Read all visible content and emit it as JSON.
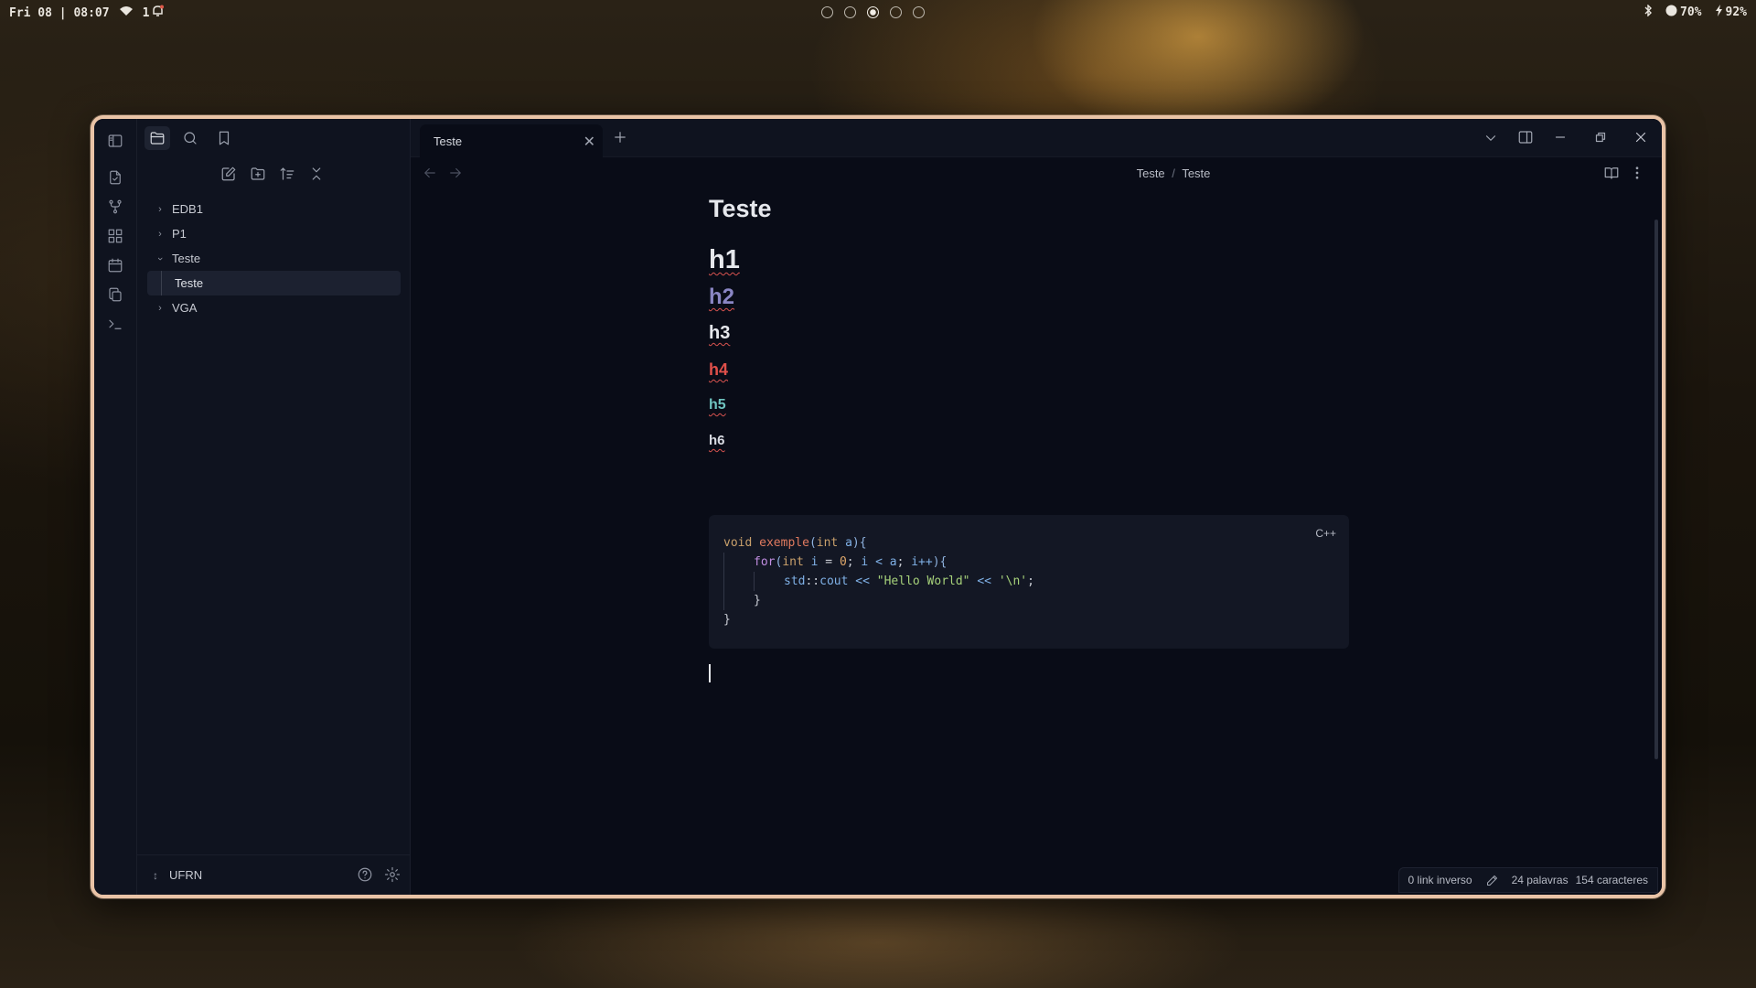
{
  "topbar": {
    "datetime": "Fri 08 | 08:07",
    "notifications": "1",
    "workspaces": [
      false,
      false,
      true,
      false,
      false
    ],
    "volume": "70%",
    "battery": "92%"
  },
  "ribbon": {
    "icons": [
      "file-plus-icon",
      "git-branch-icon",
      "layout-grid-icon",
      "calendar-icon",
      "copy-icon",
      "terminal-icon"
    ]
  },
  "sidebar": {
    "tree": [
      {
        "label": "EDB1",
        "expanded": false
      },
      {
        "label": "P1",
        "expanded": false
      },
      {
        "label": "Teste",
        "expanded": true,
        "children": [
          {
            "label": "Teste",
            "active": true
          }
        ]
      },
      {
        "label": "VGA",
        "expanded": false
      }
    ],
    "vault_name": "UFRN"
  },
  "tabs": [
    {
      "label": "Teste",
      "active": true
    }
  ],
  "breadcrumb": {
    "folder": "Teste",
    "sep": "/",
    "file": "Teste"
  },
  "editor": {
    "title": "Teste",
    "headings": [
      {
        "label": "h1",
        "color": "#e6e8ed"
      },
      {
        "label": "h2",
        "color": "#8a86c4"
      },
      {
        "label": "h3",
        "color": "#e6e8ed"
      },
      {
        "label": "h4",
        "color": "#e0504a"
      },
      {
        "label": "h5",
        "color": "#6fc4c0"
      },
      {
        "label": "h6",
        "color": "#d8dbe2"
      }
    ],
    "code": {
      "language": "C++",
      "lines": [
        "void exemple(int a){",
        "    for(int i = 0; i < a; i++){",
        "        std::cout << \"Hello World\" << '\\n';",
        "    }",
        "}"
      ]
    }
  },
  "status": {
    "backlinks": "0 link inverso",
    "words": "24 palavras",
    "chars": "154 caracteres"
  },
  "colors": {
    "window_border": "#e9c3a6",
    "background": "#090c17",
    "sidebar": "#0f131f"
  }
}
